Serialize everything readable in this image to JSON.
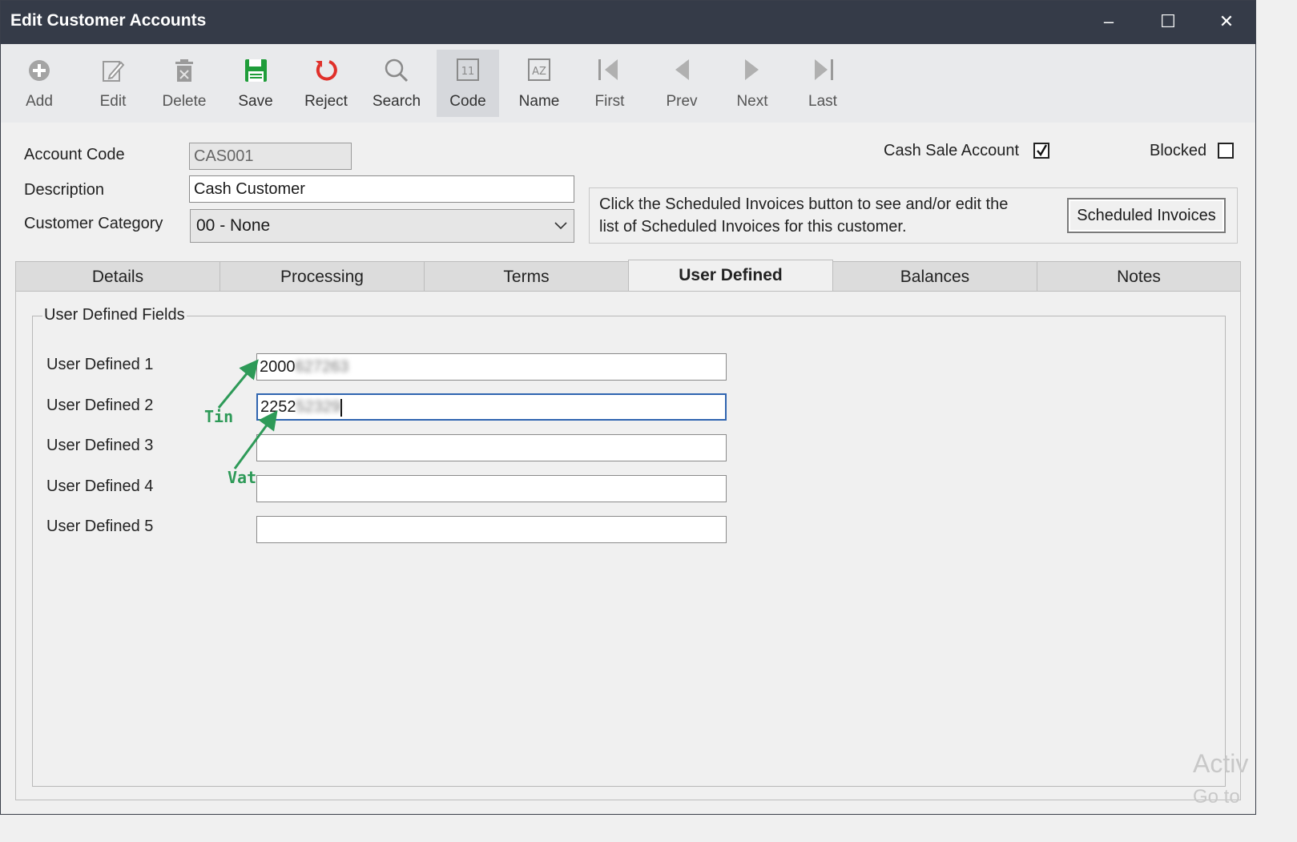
{
  "window": {
    "title": "Edit Customer Accounts",
    "controls": {
      "minimize": "–",
      "maximize": "☐",
      "close": "✕"
    }
  },
  "toolbar": [
    {
      "id": "add",
      "label": "Add",
      "icon": "plus-circle-icon",
      "enabled": false
    },
    {
      "id": "edit",
      "label": "Edit",
      "icon": "pencil-note-icon",
      "enabled": false
    },
    {
      "id": "delete",
      "label": "Delete",
      "icon": "trash-icon",
      "enabled": false
    },
    {
      "id": "save",
      "label": "Save",
      "icon": "floppy-disk-icon",
      "enabled": true,
      "color": "#1f9d3a"
    },
    {
      "id": "reject",
      "label": "Reject",
      "icon": "undo-circle-icon",
      "enabled": true,
      "color": "#e0302a"
    },
    {
      "id": "search",
      "label": "Search",
      "icon": "magnifier-icon",
      "enabled": true
    },
    {
      "id": "code",
      "label": "Code",
      "icon": "code-index-icon",
      "enabled": true,
      "active": true
    },
    {
      "id": "name",
      "label": "Name",
      "icon": "name-index-icon",
      "enabled": true
    },
    {
      "id": "first",
      "label": "First",
      "icon": "first-record-icon",
      "enabled": false
    },
    {
      "id": "prev",
      "label": "Prev",
      "icon": "prev-record-icon",
      "enabled": false
    },
    {
      "id": "next",
      "label": "Next",
      "icon": "next-record-icon",
      "enabled": false
    },
    {
      "id": "last",
      "label": "Last",
      "icon": "last-record-icon",
      "enabled": false
    }
  ],
  "form": {
    "account_code_label": "Account Code",
    "account_code_value": "CAS001",
    "description_label": "Description",
    "description_value": "Cash Customer",
    "category_label": "Customer Category",
    "category_value": "00 - None",
    "cash_sale_label": "Cash Sale Account",
    "cash_sale_checked": true,
    "blocked_label": "Blocked",
    "blocked_checked": false,
    "info_line1": "Click the Scheduled Invoices button to see and/or edit the",
    "info_line2": "list of Scheduled Invoices for this customer.",
    "scheduled_button": "Scheduled Invoices"
  },
  "tabs": [
    "Details",
    "Processing",
    "Terms",
    "User Defined",
    "Balances",
    "Notes"
  ],
  "active_tab": "User Defined",
  "user_defined": {
    "group_title": "User Defined Fields",
    "fields": [
      {
        "label": "User Defined 1",
        "value_visible": "2000",
        "value_blurred": "627263"
      },
      {
        "label": "User Defined 2",
        "value_visible": "2252",
        "value_blurred": "52329"
      },
      {
        "label": "User Defined 3",
        "value_visible": "",
        "value_blurred": ""
      },
      {
        "label": "User Defined 4",
        "value_visible": "",
        "value_blurred": ""
      },
      {
        "label": "User Defined 5",
        "value_visible": "",
        "value_blurred": ""
      }
    ]
  },
  "annotations": {
    "tin": "Tin",
    "vat": "Vat",
    "color": "#2e9a58"
  },
  "watermark": {
    "line1": "Activ",
    "line2": "Go to"
  }
}
